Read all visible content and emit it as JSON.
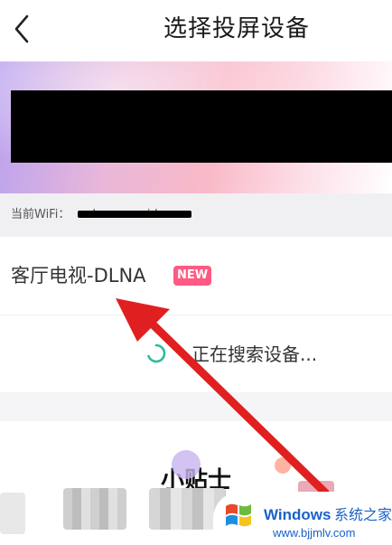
{
  "header": {
    "title": "选择投屏设备"
  },
  "wifi": {
    "label": "当前WiFi：",
    "ssid": "unknown ssid"
  },
  "devices": [
    {
      "name": "客厅电视-DLNA",
      "badge": "NEW"
    }
  ],
  "search": {
    "status_text": "正在搜索设备..."
  },
  "tips": {
    "title": "小贴士"
  },
  "watermark": {
    "brand": "Windows",
    "brand_cn": "系统之家",
    "url": "www.bjjmlv.com"
  },
  "colors": {
    "badge": "#ff5a82",
    "spinner": "#2dbb9b",
    "arrow": "#e02020",
    "watermark_blue": "#1a62c8"
  },
  "icons": {
    "back": "chevron-left-icon",
    "spinner": "loading-spinner-icon",
    "logo": "windows-logo-icon"
  }
}
